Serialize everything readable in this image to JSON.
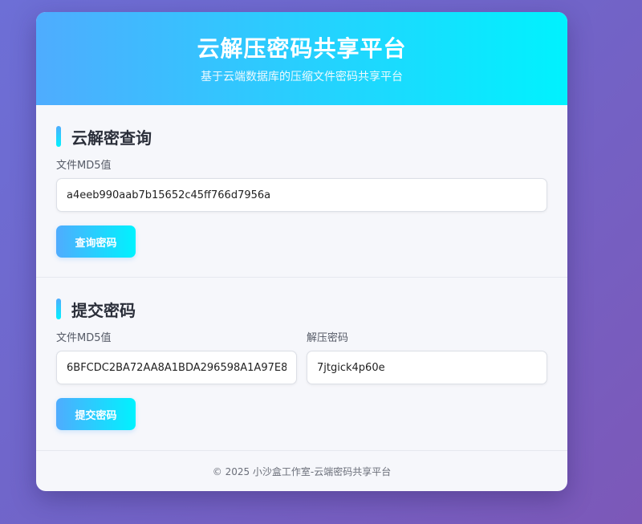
{
  "header": {
    "title": "云解压密码共享平台",
    "subtitle": "基于云端数据库的压缩文件密码共享平台"
  },
  "query_section": {
    "title": "云解密查询",
    "md5_label": "文件MD5值",
    "md5_value": "a4eeb990aab7b15652c45ff766d7956a",
    "button_label": "查询密码"
  },
  "submit_section": {
    "title": "提交密码",
    "md5_label": "文件MD5值",
    "md5_value": "6BFCDC2BA72AA8A1BDA296598A1A97E8",
    "password_label": "解压密码",
    "password_value": "7jtgick4p60e",
    "button_label": "提交密码"
  },
  "footer": {
    "text": "© 2025 小沙盒工作室-云端密码共享平台"
  },
  "colors": {
    "accent_start": "#4facfe",
    "accent_end": "#00f2fe",
    "background": "#7164c8"
  }
}
